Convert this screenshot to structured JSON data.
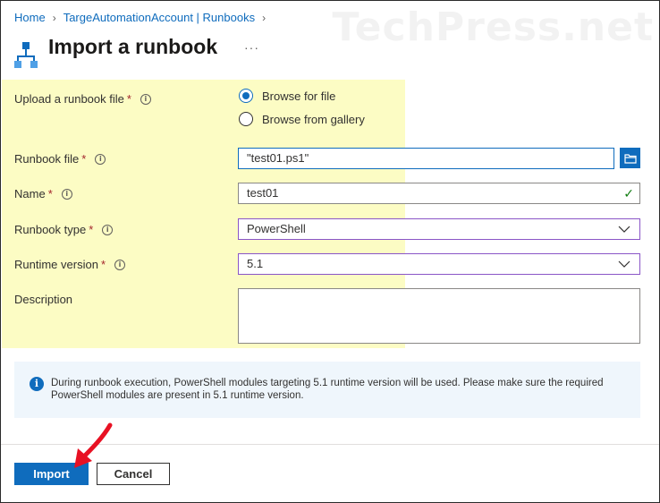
{
  "watermark": "TechPress.net",
  "breadcrumb": {
    "home": "Home",
    "account": "TargeAutomationAccount | Runbooks"
  },
  "header": {
    "title": "Import a runbook",
    "more": "···"
  },
  "form": {
    "upload_label": "Upload a runbook file",
    "required_mark": "*",
    "radio_browse_file": "Browse for file",
    "radio_browse_gallery": "Browse from gallery",
    "selected_source": "Browse for file",
    "runbook_file_label": "Runbook file",
    "runbook_file_value": "\"test01.ps1\"",
    "name_label": "Name",
    "name_value": "test01",
    "type_label": "Runbook type",
    "type_value": "PowerShell",
    "runtime_label": "Runtime version",
    "runtime_value": "5.1",
    "description_label": "Description",
    "description_value": ""
  },
  "infobar": {
    "line1": "During runbook execution, PowerShell modules targeting 5.1 runtime version will be used. Please make sure the required",
    "line2": "PowerShell modules are present in 5.1 runtime version."
  },
  "footer": {
    "import_label": "Import",
    "cancel_label": "Cancel"
  },
  "colors": {
    "accent": "#0f6cbd",
    "highlight": "#fcfcc4",
    "info_bg": "#eff6fc",
    "arrow": "#e81123",
    "valid": "#107c10"
  },
  "icons": [
    "chevron-right-icon",
    "runbook-icon",
    "info-icon",
    "folder-icon",
    "checkmark-icon",
    "chevron-down-icon",
    "info-circle-icon",
    "arrow-annotation"
  ]
}
